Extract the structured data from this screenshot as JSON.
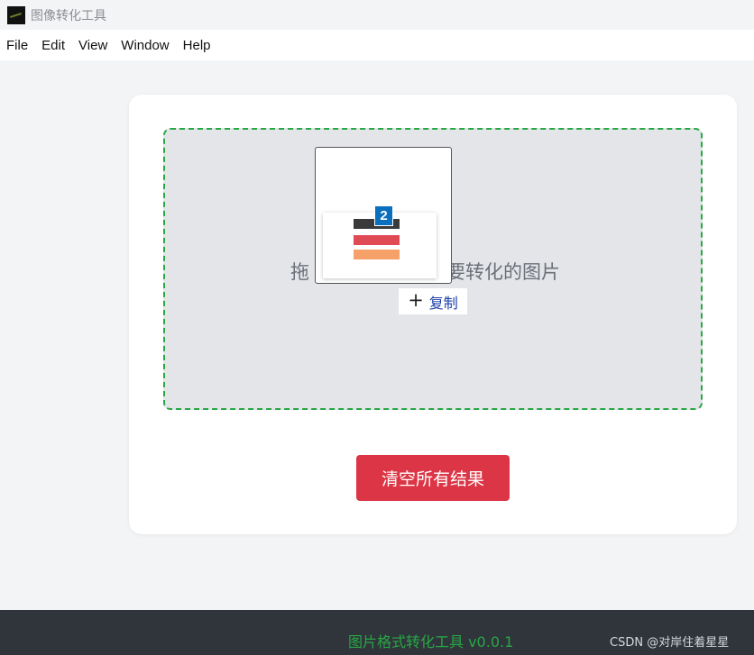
{
  "window": {
    "title": "图像转化工具"
  },
  "menu": {
    "items": [
      "File",
      "Edit",
      "View",
      "Window",
      "Help"
    ]
  },
  "dropzone": {
    "prompt_left": "拖",
    "prompt_right": "要转化的图片"
  },
  "drag_overlay": {
    "count": "2",
    "copy_label": "复制",
    "copy_icon": "plus-icon"
  },
  "actions": {
    "clear_label": "清空所有结果"
  },
  "footer": {
    "title": "图片格式转化工具 v0.0.1"
  },
  "watermark": "CSDN @对岸住着星星",
  "colors": {
    "primary_green": "#28a745",
    "danger_red": "#dc3545",
    "footer_bg": "#2f353b",
    "dropzone_bg": "#e3e5e9",
    "badge_blue": "#0a6fbd"
  }
}
